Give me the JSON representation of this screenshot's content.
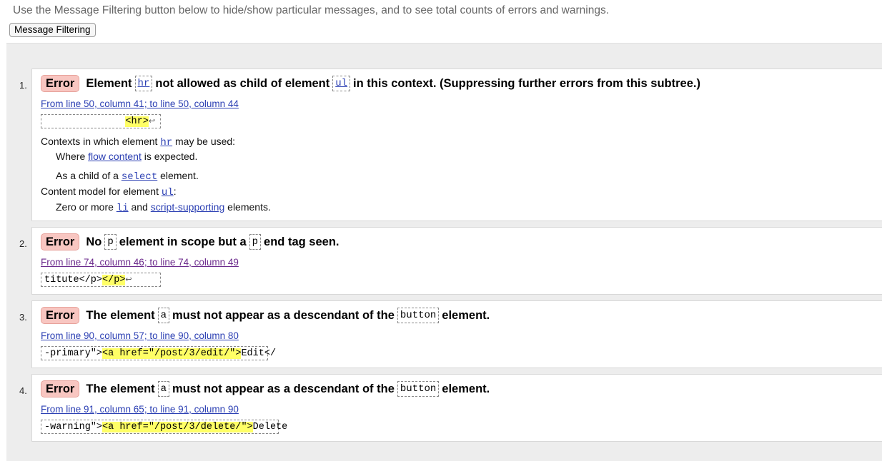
{
  "intro_text": "Use the Message Filtering button below to hide/show particular messages, and to see total counts of errors and warnings.",
  "filter_button_label": "Message Filtering",
  "messages": [
    {
      "number": "1.",
      "type": "Error",
      "text_1": "Element",
      "code_1": "hr",
      "text_2": "not allowed as child of element",
      "code_2": "ul",
      "text_3": "in this context. (Suppressing further errors from this subtree.)",
      "location": "From line 50, column 41; to line 50, column 44",
      "extract_pre": "              ",
      "extract_hl": "<hr>",
      "extract_post": "",
      "lf": "↩",
      "ctx_label_pre": "Contexts in which element",
      "ctx_label_code": "hr",
      "ctx_label_post": "may be used:",
      "ctx_1_pre": "Where",
      "ctx_1_link": "flow content",
      "ctx_1_post": "is expected.",
      "ctx_2_pre": "As a child of a",
      "ctx_2_code": "select",
      "ctx_2_post": "element.",
      "model_label_pre": "Content model for element",
      "model_label_code": "ul",
      "model_label_post": ":",
      "model_1_pre": "Zero or more",
      "model_1_code": "li",
      "model_1_mid": "and",
      "model_1_link": "script-supporting",
      "model_1_post": "elements."
    },
    {
      "number": "2.",
      "type": "Error",
      "text_1": "No",
      "code_1": "p",
      "text_2": "element in scope but a",
      "code_2": "p",
      "text_3": "end tag seen.",
      "location": "From line 74, column 46; to line 74, column 49",
      "extract_pre": "titute</p>",
      "extract_hl": "</p>",
      "extract_post": "",
      "lf": "↩"
    },
    {
      "number": "3.",
      "type": "Error",
      "text_1": "The element",
      "code_1": "a",
      "text_2": "must not appear as a descendant of the",
      "code_2": "button",
      "text_3": "element.",
      "location": "From line 90, column 57; to line 90, column 80",
      "extract_pre": "-primary\">",
      "extract_hl": "<a href=\"/post/3/edit/\">",
      "extract_post": "Edit</"
    },
    {
      "number": "4.",
      "type": "Error",
      "text_1": "The element",
      "code_1": "a",
      "text_2": "must not appear as a descendant of the",
      "code_2": "button",
      "text_3": "element.",
      "location": "From line 91, column 65; to line 91, column 90",
      "extract_pre": "-warning\">",
      "extract_hl": "<a href=\"/post/3/delete/\">",
      "extract_post": "Delete"
    }
  ]
}
